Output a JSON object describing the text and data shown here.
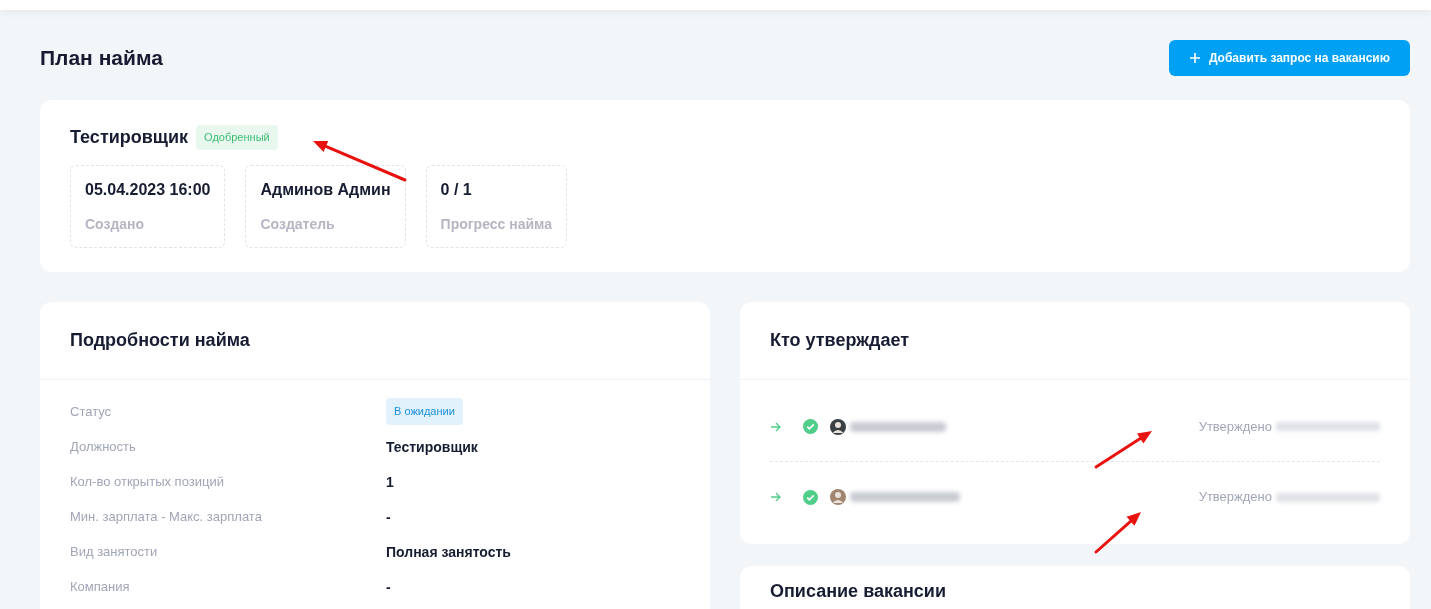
{
  "page_title": "План найма",
  "add_button": {
    "label": "Добавить запрос на вакансию"
  },
  "summary": {
    "title": "Тестировщик",
    "status": {
      "label": "Одобренный",
      "kind": "approved"
    },
    "stats": [
      {
        "value": "05.04.2023 16:00",
        "label": "Создано"
      },
      {
        "value": "Админов Админ",
        "label": "Создатель"
      },
      {
        "value": "0 / 1",
        "label": "Прогресс найма"
      }
    ]
  },
  "details": {
    "title": "Подробности найма",
    "rows": [
      {
        "label": "Статус",
        "value": "В ожидании",
        "kind": "badge"
      },
      {
        "label": "Должность",
        "value": "Тестировщик",
        "kind": "text"
      },
      {
        "label": "Кол-во открытых позиций",
        "value": "1",
        "kind": "text"
      },
      {
        "label": "Мин. зарплата - Макс. зарплата",
        "value": "-",
        "kind": "text"
      },
      {
        "label": "Вид занятости",
        "value": "Полная занятость",
        "kind": "text"
      },
      {
        "label": "Компания",
        "value": "-",
        "kind": "text"
      }
    ]
  },
  "approvers": {
    "title": "Кто утверждает",
    "items": [
      {
        "approved": true,
        "result": "Утверждено"
      },
      {
        "approved": true,
        "result": "Утверждено"
      }
    ]
  },
  "description": {
    "title": "Описание вакансии"
  }
}
